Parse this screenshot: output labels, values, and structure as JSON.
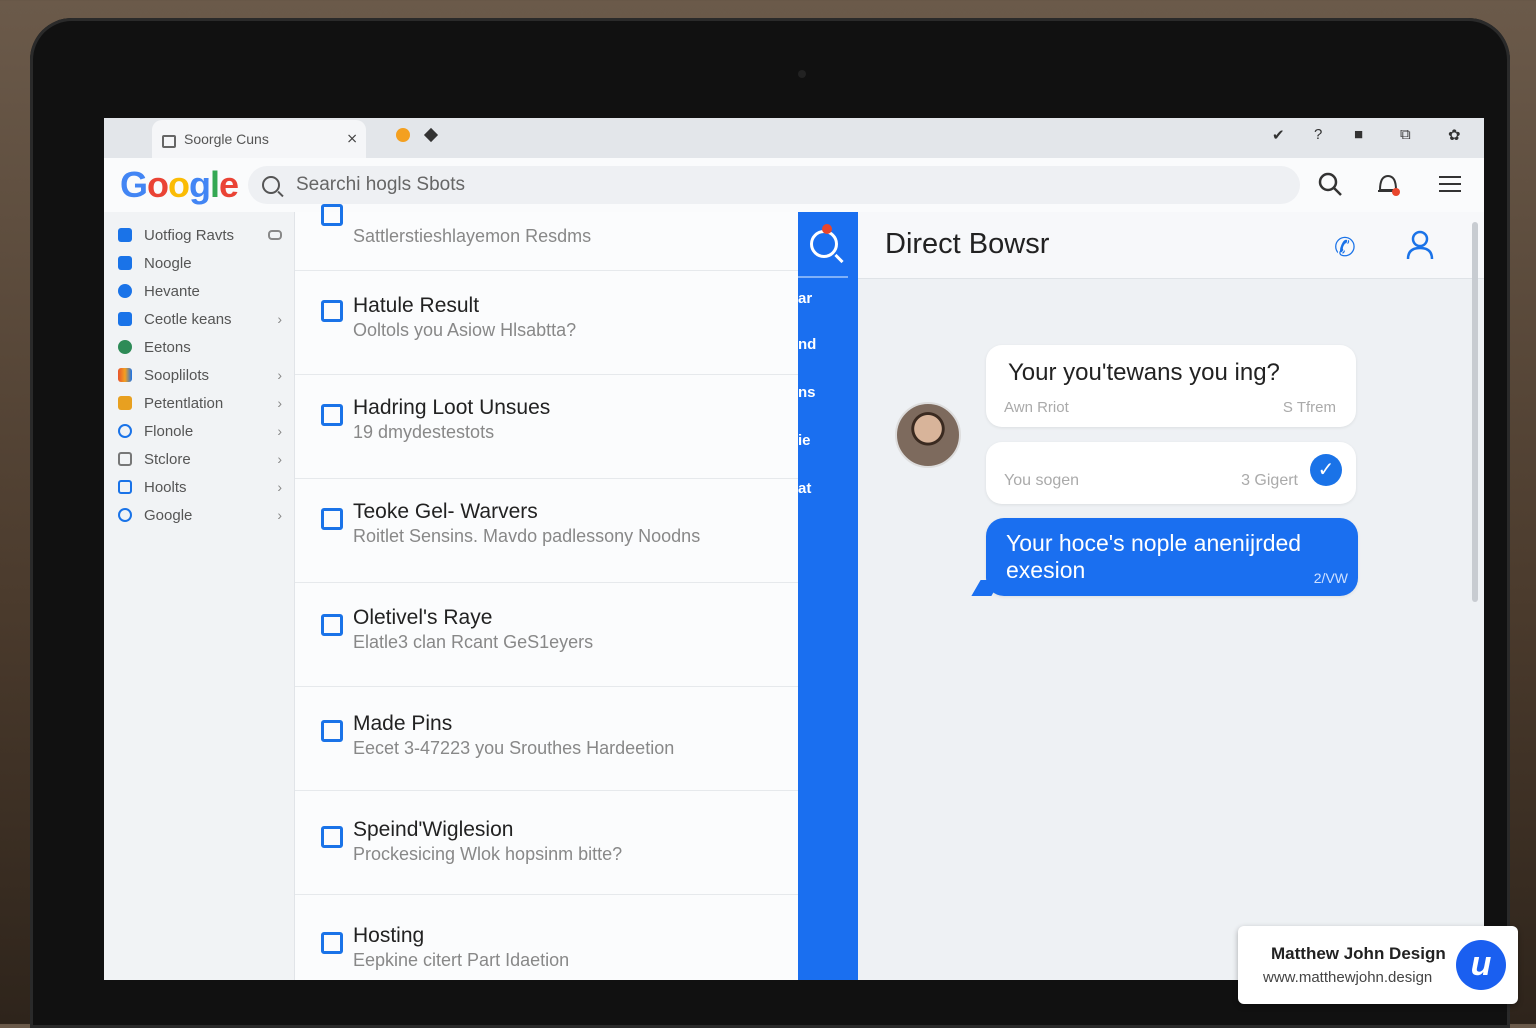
{
  "browser": {
    "tab_title": "Soorgle Cuns",
    "tab_close": "⨯",
    "toolbar_icons": [
      "✔",
      "?",
      "■",
      "⧉",
      "✿"
    ]
  },
  "logo": {
    "text": "Google"
  },
  "search": {
    "value": "Searchi hogls Sbots"
  },
  "sidebar": {
    "items": [
      {
        "label": "Uotfiog Ravts",
        "icon": "facebook-icon",
        "color": "#1a73e8",
        "chevron": false,
        "toggle": true
      },
      {
        "label": "Noogle",
        "icon": "grid-icon",
        "color": "#1a73e8",
        "chevron": false
      },
      {
        "label": "Hevante",
        "icon": "share-icon",
        "color": "#1a73e8",
        "chevron": false
      },
      {
        "label": "Ceotle keans",
        "icon": "card-icon",
        "color": "#1a73e8",
        "chevron": true
      },
      {
        "label": "Eetons",
        "icon": "badge-icon",
        "color": "#2e8b57",
        "chevron": false
      },
      {
        "label": "Sooplilots",
        "icon": "palette-icon",
        "color": "#e8542c",
        "chevron": true
      },
      {
        "label": "Petentlation",
        "icon": "bag-icon",
        "color": "#e8a020",
        "chevron": true
      },
      {
        "label": "Flonole",
        "icon": "clock-icon",
        "color": "#1a73e8",
        "chevron": true
      },
      {
        "label": "Stclore",
        "icon": "square-icon",
        "color": "#777777",
        "chevron": true
      },
      {
        "label": "Hoolts",
        "icon": "window-icon",
        "color": "#1a73e8",
        "chevron": true
      },
      {
        "label": "Google",
        "icon": "circle-icon",
        "color": "#1a73e8",
        "chevron": true
      }
    ]
  },
  "results": [
    {
      "title": "",
      "sub": "Sattlerstieshlayemon Resdms"
    },
    {
      "title": "Hatule Result",
      "sub": "Ooltols you Asiow Hlsabtta?"
    },
    {
      "title": "Hadring Loot Unsues",
      "sub": "19 dmydestestots"
    },
    {
      "title": "Teoke Gel- Warvers",
      "sub": "Roitlet Sensins. Mavdo padlessony Noodns"
    },
    {
      "title": "Oletivel's Raye",
      "sub": "Elatle3 clan Rcant GeS1eyers"
    },
    {
      "title": "Made Pins",
      "sub": "Eecet 3-47223 you Srouthes Hardeetion"
    },
    {
      "title": "Speind'Wiglesion",
      "sub": "Prockesicing Wlok hopsinm bitte?"
    },
    {
      "title": "Hosting",
      "sub": "Eepkine citert Part Idaetion"
    }
  ],
  "bluestrip": {
    "fragments": [
      "ar",
      "nd",
      "ns",
      "ie",
      "at"
    ]
  },
  "chat": {
    "title": "Direct Bowsr",
    "messages": [
      {
        "text": "Your you'tewans you ing?",
        "meta_left": "Awn Rriot",
        "meta_right": "S Tfrem"
      },
      {
        "meta_left": "You sogen",
        "meta_right": "3 Gigert",
        "check": "✓"
      },
      {
        "text": "Your hoce's nople anenijrded exesion",
        "time": "2/VW"
      }
    ]
  },
  "watermark": {
    "name": "Matthew John Design",
    "url": "www.matthewjohn.design",
    "logo_letter": "u"
  },
  "colors": {
    "accent": "#1a6ff0",
    "background": "#f4f6f8"
  }
}
